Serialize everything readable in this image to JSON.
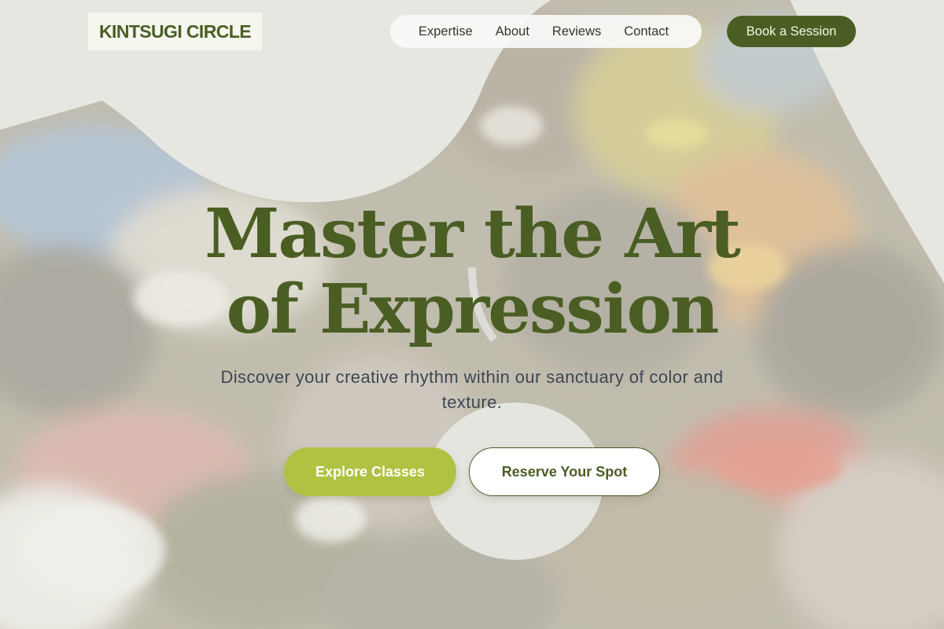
{
  "brand": {
    "name": "KINTSUGI CIRCLE"
  },
  "nav": {
    "items": [
      {
        "label": "Expertise"
      },
      {
        "label": "About"
      },
      {
        "label": "Reviews"
      },
      {
        "label": "Contact"
      }
    ],
    "cta_label": "Book a Session"
  },
  "hero": {
    "headline_line1": "Master the Art",
    "headline_line2": "of Expression",
    "subtext": "Discover your creative rhythm within our sanctuary of color and texture.",
    "primary_button": "Explore Classes",
    "secondary_button": "Reserve Your Spot",
    "background_image": "paint-palette-image"
  },
  "colors": {
    "brand_green": "#4a5e23",
    "accent_lime": "#b1c243",
    "text_slate": "#3d4653"
  }
}
